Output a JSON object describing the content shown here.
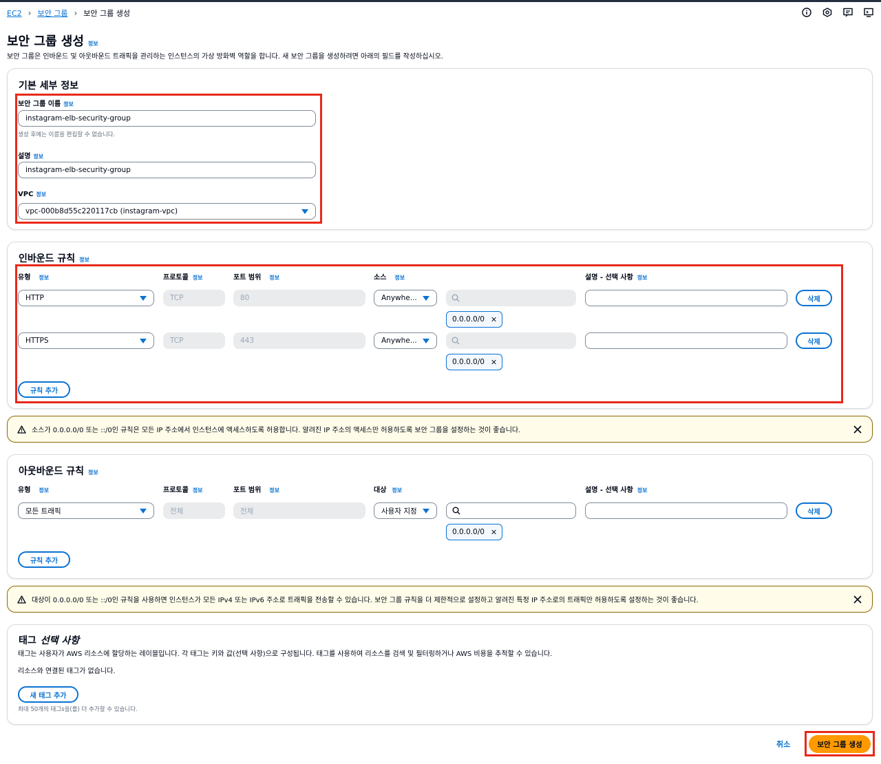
{
  "breadcrumb": {
    "root": "EC2",
    "parent": "보안 그룹",
    "current": "보안 그룹 생성"
  },
  "header": {
    "title": "보안 그룹 생성",
    "info": "정보",
    "description": "보안 그룹은 인바운드 및 아웃바운드 트래픽을 관리하는 인스턴스의 가상 방화벽 역할을 합니다. 새 보안 그룹을 생성하려면 아래의 필드를 작성하십시오."
  },
  "basic": {
    "title": "기본 세부 정보",
    "info": "정보",
    "name_label": "보안 그룹 이름",
    "name_value": "instagram-elb-security-group",
    "name_hint": "생성 후에는 이름을 편집할 수 없습니다.",
    "desc_label": "설명",
    "desc_value": "instagram-elb-security-group",
    "vpc_label": "VPC",
    "vpc_value": "vpc-000b8d55c220117cb (instagram-vpc)"
  },
  "inbound": {
    "title": "인바운드 규칙",
    "info": "정보",
    "columns": {
      "type": "유형",
      "protocol": "프로토콜",
      "port": "포트 범위",
      "source": "소스",
      "desc": "설명 - 선택 사항"
    },
    "rules": [
      {
        "type": "HTTP",
        "protocol": "TCP",
        "port": "80",
        "source": "Anywhe...",
        "cidr": "0.0.0.0/0",
        "delete": "삭제"
      },
      {
        "type": "HTTPS",
        "protocol": "TCP",
        "port": "443",
        "source": "Anywhe...",
        "cidr": "0.0.0.0/0",
        "delete": "삭제"
      }
    ],
    "add_rule": "규칙 추가"
  },
  "alert_inbound": "소스가 0.0.0.0/0 또는 ::/0인 규칙은 모든 IP 주소에서 인스턴스에 액세스하도록 허용합니다. 알려진 IP 주소의 액세스만 허용하도록 보안 그룹을 설정하는 것이 좋습니다.",
  "outbound": {
    "title": "아웃바운드 규칙",
    "info": "정보",
    "columns": {
      "type": "유형",
      "protocol": "프로토콜",
      "port": "포트 범위",
      "dest": "대상",
      "desc": "설명 - 선택 사항"
    },
    "rules": [
      {
        "type": "모든 트래픽",
        "protocol": "전체",
        "port": "전체",
        "dest": "사용자 지정",
        "cidr": "0.0.0.0/0",
        "delete": "삭제"
      }
    ],
    "add_rule": "규칙 추가"
  },
  "alert_outbound": "대상이 0.0.0.0/0 또는 ::/0인 규칙을 사용하면 인스턴스가 모든 IPv4 또는 IPv6 주소로 트래픽을 전송할 수 있습니다. 보안 그룹 규칙을 더 제한적으로 설정하고 알려진 특정 IP 주소로의 트래픽만 허용하도록 설정하는 것이 좋습니다.",
  "tags": {
    "title": "태그",
    "title_optional": "선택 사항",
    "description": "태그는 사용자가 AWS 리소스에 할당하는 레이블입니다. 각 태그는 키와 값(선택 사항)으로 구성됩니다. 태그를 사용하여 리소스를 검색 및 필터링하거나 AWS 비용을 추적할 수 있습니다.",
    "empty": "리소스와 연결된 태그가 없습니다.",
    "add_tag": "새 태그 추가",
    "limit": "최대 50개의 태그s을(를) 더 추가할 수 있습니다."
  },
  "footer": {
    "cancel": "취소",
    "submit": "보안 그룹 생성"
  },
  "colors": {
    "link": "#0972d3",
    "primary": "#ff9900",
    "highlight": "#e8281a",
    "warning_border": "#8d6605",
    "warning_bg": "#fffce9"
  }
}
